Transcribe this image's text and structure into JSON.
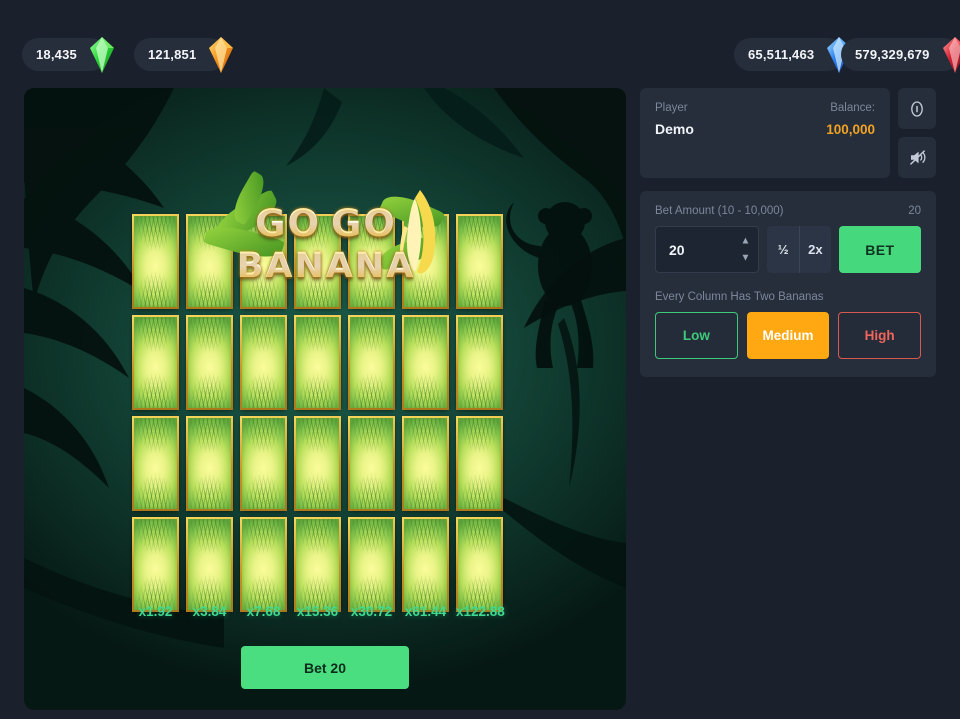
{
  "topbar": {
    "currencies": [
      {
        "name": "emerald",
        "amount": "18,435",
        "color": "#3fdd3a",
        "icon": "gem-green-icon"
      },
      {
        "name": "topaz",
        "amount": "121,851",
        "color": "#f2a020",
        "icon": "gem-orange-icon"
      },
      {
        "name": "sapphire",
        "amount": "65,511,463",
        "color": "#2f86ef",
        "icon": "gem-blue-icon"
      },
      {
        "name": "ruby",
        "amount": "579,329,679",
        "color": "#d42032",
        "icon": "gem-red-icon"
      }
    ]
  },
  "game": {
    "logo": {
      "line1": "GO GO",
      "line2": "BANANA"
    },
    "grid": {
      "columns": 7,
      "rows": 4
    },
    "multipliers": [
      "x1.92",
      "x3.84",
      "x7.68",
      "x15.36",
      "x30.72",
      "x61.44",
      "x122.88"
    ],
    "cta_label": "Bet 20"
  },
  "panel": {
    "account": {
      "player_label": "Player",
      "player_name": "Demo",
      "balance_label": "Balance:",
      "balance_value": "100,000",
      "balance_color": "#f0a323"
    },
    "icons": {
      "info": "info-icon",
      "mute": "sound-muted-icon"
    },
    "bet": {
      "label": "Bet Amount (10 - 10,000)",
      "display_value": "20",
      "input_value": "20",
      "half_label": "½",
      "double_label": "2x",
      "bet_label": "BET"
    },
    "risk": {
      "label": "Every Column Has Two Bananas",
      "options": [
        {
          "label": "Low",
          "selected": false,
          "color": "#3fc97a"
        },
        {
          "label": "Medium",
          "selected": true,
          "color": "#ffa812"
        },
        {
          "label": "High",
          "selected": false,
          "color": "#f0655c"
        }
      ]
    }
  }
}
